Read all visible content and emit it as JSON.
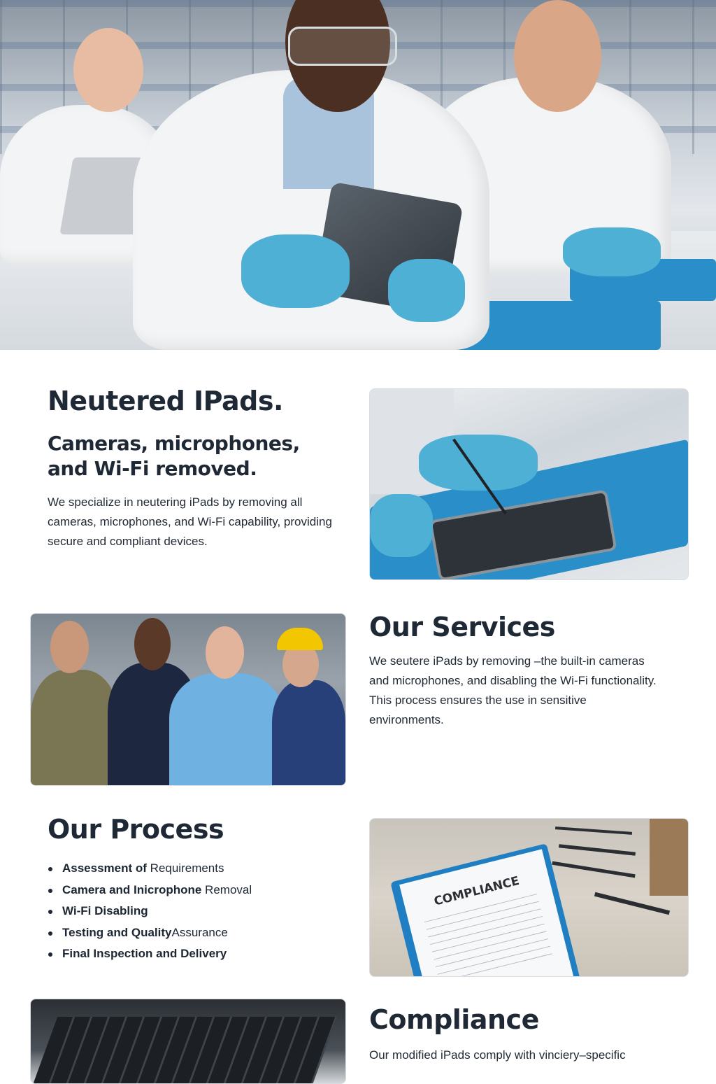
{
  "hero": {
    "alt_icon": "lab-technicians-photo"
  },
  "intro": {
    "title": "Neutered IPads.",
    "subtitle": "Cameras, microphones, and Wi-Fi removed.",
    "text": "We specialize in neutering iPads by removing all cameras, microphones, and Wi-Fi capability, providing secure and compliant devices."
  },
  "services": {
    "title": "Our Services",
    "text": "We seutere iPads by removing –the built-in cameras and microphones, and disabling the Wi-Fi functionality. This process ensures the use in sensitive environments."
  },
  "process": {
    "title": "Our Process",
    "items": [
      {
        "bold": "Assessment of",
        "rest": " Requirements"
      },
      {
        "bold": "Camera and Inicrophone",
        "rest": " Removal"
      },
      {
        "bold": "Wi-Fi Disabling",
        "rest": ""
      },
      {
        "bold": "Testing and Quality",
        "rest": "Assurance"
      },
      {
        "bold": "Final Inspection and Delivery",
        "rest": ""
      }
    ]
  },
  "compliance": {
    "title": "Compliance",
    "text": "Our modified iPads comply with vinciery–specific",
    "clipboard_label": "COMPLIANCE"
  },
  "colors": {
    "accent_blue": "#2a8fc8",
    "heading": "#1e2935"
  }
}
